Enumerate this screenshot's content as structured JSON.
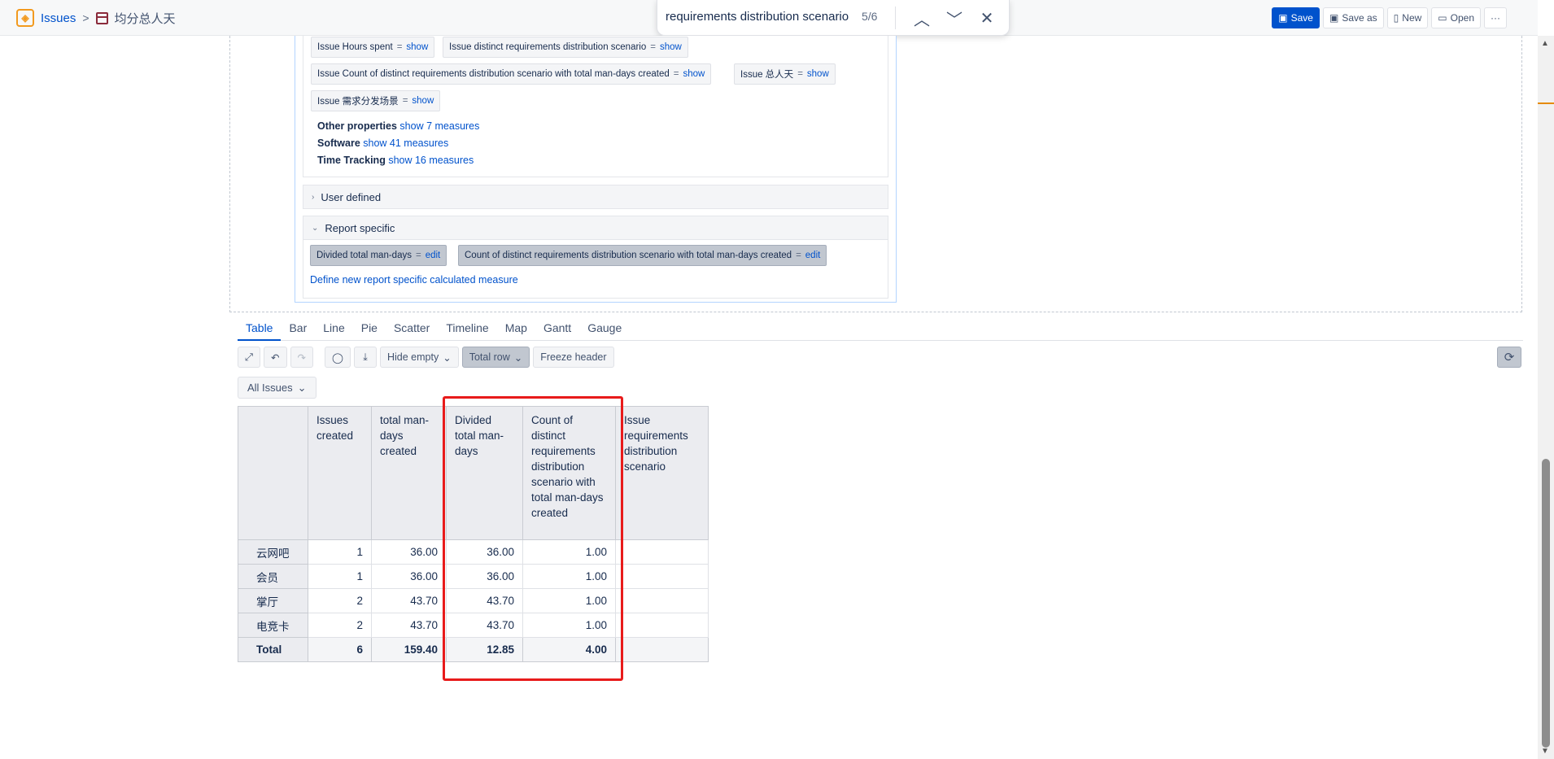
{
  "header": {
    "crumb_issues": "Issues",
    "crumb_separator": ">",
    "page_title": "均分总人天",
    "actions": {
      "save": "Save",
      "save_as": "Save as",
      "new": "New",
      "open": "Open",
      "more": "···"
    }
  },
  "find": {
    "query": "requirements distribution scenario",
    "count": "5/6"
  },
  "measures": {
    "chips_row1": [
      {
        "label": "Issue Hours spent",
        "eq": "=",
        "action": "show"
      },
      {
        "label": "Issue distinct requirements distribution scenario",
        "eq": "=",
        "action": "show"
      }
    ],
    "chips_row2": [
      {
        "label": "Issue Count of distinct requirements distribution scenario with total man-days created",
        "eq": "=",
        "action": "show"
      },
      {
        "label": "Issue 总人天",
        "eq": "=",
        "action": "show"
      }
    ],
    "chips_row3": [
      {
        "label": "Issue 需求分发场景",
        "eq": "=",
        "action": "show"
      }
    ],
    "groups": [
      {
        "name": "Other properties",
        "link": "show 7 measures"
      },
      {
        "name": "Software",
        "link": "show 41 measures"
      },
      {
        "name": "Time Tracking",
        "link": "show 16 measures"
      }
    ],
    "user_defined": "User defined",
    "report_specific": "Report specific",
    "report_chips": [
      {
        "label": "Divided total man-days",
        "eq": "=",
        "action": "edit"
      },
      {
        "label": "Count of distinct requirements distribution scenario with total man-days created",
        "eq": "=",
        "action": "edit"
      }
    ],
    "define_new": "Define new report specific calculated measure"
  },
  "tabs": [
    "Table",
    "Bar",
    "Line",
    "Pie",
    "Scatter",
    "Timeline",
    "Map",
    "Gantt",
    "Gauge"
  ],
  "toolbar": {
    "hide_empty": "Hide empty",
    "total_row": "Total row",
    "freeze_header": "Freeze header"
  },
  "filter": {
    "all_issues": "All Issues"
  },
  "table": {
    "headers": [
      "Issues created",
      "total man-days created",
      "Divided total man-days",
      "Count of distinct requirements distribution scenario with total man-days created",
      "Issue requirements distribution scenario"
    ],
    "rows": [
      {
        "label": "云网吧",
        "values": [
          "1",
          "36.00",
          "36.00",
          "1.00",
          ""
        ]
      },
      {
        "label": "会员",
        "values": [
          "1",
          "36.00",
          "36.00",
          "1.00",
          ""
        ]
      },
      {
        "label": "掌厅",
        "values": [
          "2",
          "43.70",
          "43.70",
          "1.00",
          ""
        ]
      },
      {
        "label": "电竞卡",
        "values": [
          "2",
          "43.70",
          "43.70",
          "1.00",
          ""
        ]
      }
    ],
    "total": {
      "label": "Total",
      "values": [
        "6",
        "159.40",
        "12.85",
        "4.00",
        ""
      ]
    }
  },
  "colors": {
    "accent": "#0052cc",
    "highlight": "#e81b1b",
    "scroll_marker": "#e58a00"
  }
}
